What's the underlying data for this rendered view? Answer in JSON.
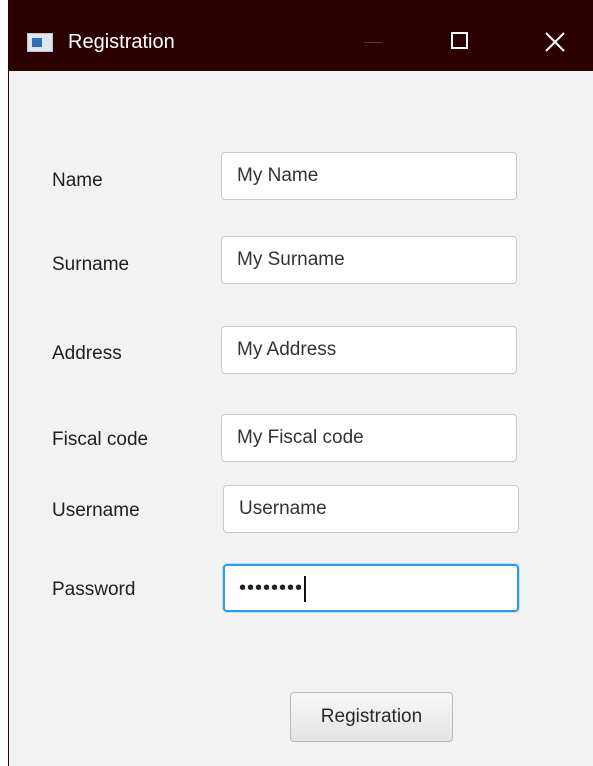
{
  "window": {
    "title": "Registration",
    "icon": "app-window-icon",
    "controls": [
      "minimize-icon",
      "maximize-icon",
      "close-icon"
    ]
  },
  "form": {
    "name": {
      "label": "Name",
      "value": "My Name"
    },
    "surname": {
      "label": "Surname",
      "value": "My Surname"
    },
    "address": {
      "label": "Address",
      "value": "My Address"
    },
    "fiscal_code": {
      "label": "Fiscal code",
      "value": "My Fiscal code"
    },
    "username": {
      "label": "Username",
      "value": "Username"
    },
    "password": {
      "label": "Password",
      "masked_value": "••••••••"
    }
  },
  "submit_label": "Registration",
  "colors": {
    "titlebar": "#2b0000",
    "background": "#f2f2f2",
    "focus_border": "#2f9be4"
  }
}
